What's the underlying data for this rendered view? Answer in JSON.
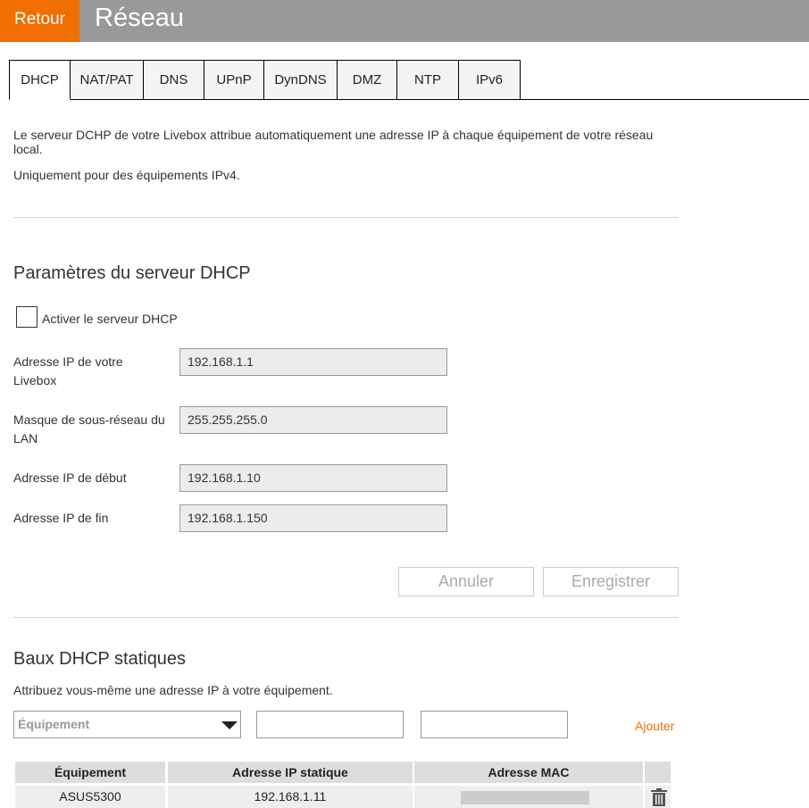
{
  "header": {
    "back_label": "Retour",
    "title": "Réseau"
  },
  "tabs": [
    {
      "label": "DHCP",
      "active": true
    },
    {
      "label": "NAT/PAT",
      "active": false
    },
    {
      "label": "DNS",
      "active": false
    },
    {
      "label": "UPnP",
      "active": false
    },
    {
      "label": "DynDNS",
      "active": false
    },
    {
      "label": "DMZ",
      "active": false
    },
    {
      "label": "NTP",
      "active": false
    },
    {
      "label": "IPv6",
      "active": false
    }
  ],
  "intro": {
    "text": "Le serveur DCHP de votre Livebox attribue automatiquement une adresse IP à chaque équipement de votre réseau local.",
    "note": "Uniquement pour des équipements IPv4."
  },
  "dhcp_settings": {
    "title": "Paramètres du serveur DHCP",
    "enable_label": "Activer le serveur DHCP",
    "enabled": false,
    "fields": [
      {
        "label": "Adresse IP de votre Livebox",
        "value": "192.168.1.1"
      },
      {
        "label": "Masque de sous-réseau du LAN",
        "value": "255.255.255.0"
      },
      {
        "label": "Adresse IP de début",
        "value": "192.168.1.10"
      },
      {
        "label": "Adresse IP de fin",
        "value": "192.168.1.150"
      }
    ],
    "cancel_label": "Annuler",
    "save_label": "Enregistrer"
  },
  "static_leases": {
    "title": "Baux DHCP statiques",
    "description": "Attribuez vous-même une adresse IP à votre équipement.",
    "device_placeholder": "Équipement",
    "add_label": "Ajouter",
    "columns": [
      "Équipement",
      "Adresse IP statique",
      "Adresse MAC"
    ],
    "rows": [
      {
        "device": "ASUS5300",
        "ip": "192.168.1.11"
      }
    ]
  },
  "colors": {
    "accent": "#f16e00",
    "header_bg": "#999999"
  },
  "icons": {
    "delete": "trash-icon",
    "dropdown": "chevron-down-icon"
  }
}
